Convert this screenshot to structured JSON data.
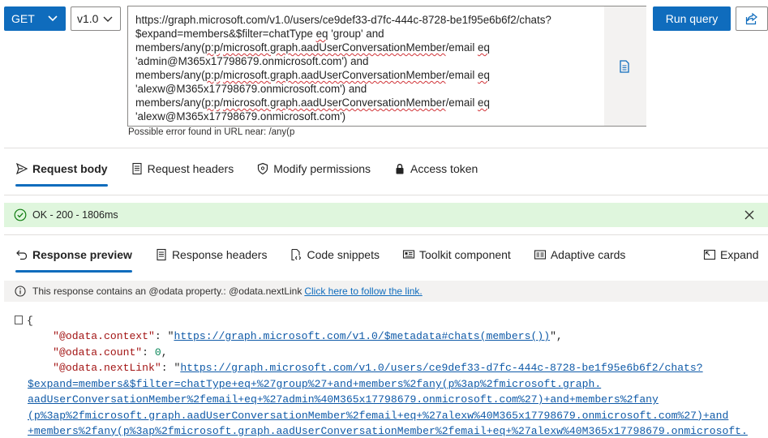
{
  "query": {
    "method": "GET",
    "version": "v1.0",
    "url_lines": [
      [
        {
          "t": "https://graph.microsoft.com/v1.0/users/ce9def33-d7fc-444c-8728-be1f95e6b6f2/chats?"
        }
      ],
      [
        {
          "t": "$expand=members&$filter=chatType "
        },
        {
          "t": "eq",
          "s": true
        },
        {
          "t": " 'group' and"
        }
      ],
      [
        {
          "t": "members/any("
        },
        {
          "t": "p:p",
          "s": true
        },
        {
          "t": "/"
        },
        {
          "t": "microsoft.graph.aadUserConversationMember",
          "s": true
        },
        {
          "t": "/email "
        },
        {
          "t": "eq",
          "s": true
        }
      ],
      [
        {
          "t": "'admin@M365x17798679.onmicrosoft.com') and"
        }
      ],
      [
        {
          "t": "members/any("
        },
        {
          "t": "p:p",
          "s": true
        },
        {
          "t": "/"
        },
        {
          "t": "microsoft.graph.aadUserConversationMember",
          "s": true
        },
        {
          "t": "/email "
        },
        {
          "t": "eq",
          "s": true
        }
      ],
      [
        {
          "t": "'alexw@M365x17798679.onmicrosoft.com') and"
        }
      ],
      [
        {
          "t": "members/any("
        },
        {
          "t": "p:p",
          "s": true
        },
        {
          "t": "/"
        },
        {
          "t": "microsoft.graph.aadUserConversationMember",
          "s": true
        },
        {
          "t": "/email "
        },
        {
          "t": "eq",
          "s": true
        }
      ],
      [
        {
          "t": "'alexw@M365x17798679.onmicrosoft.com')"
        }
      ]
    ],
    "error_hint": "Possible error found in URL near: /any(p",
    "run_label": "Run query"
  },
  "request_tabs": [
    {
      "label": "Request body",
      "icon": "send-icon",
      "active": true
    },
    {
      "label": "Request headers",
      "icon": "document-icon",
      "active": false
    },
    {
      "label": "Modify permissions",
      "icon": "shield-icon",
      "active": false
    },
    {
      "label": "Access token",
      "icon": "lock-icon",
      "active": false
    }
  ],
  "status": {
    "text": "OK - 200 - 1806ms",
    "color": "#dff6dd"
  },
  "response_tabs": [
    {
      "label": "Response preview",
      "icon": "undo-arrow-icon",
      "active": true
    },
    {
      "label": "Response headers",
      "icon": "document-icon",
      "active": false
    },
    {
      "label": "Code snippets",
      "icon": "code-file-icon",
      "active": false
    },
    {
      "label": "Toolkit component",
      "icon": "toolkit-icon",
      "active": false
    },
    {
      "label": "Adaptive cards",
      "icon": "card-icon",
      "active": false
    }
  ],
  "expand_label": "Expand",
  "info": {
    "text": "This response contains an @odata property.: @odata.nextLink",
    "link": "Click here to follow the link."
  },
  "response": {
    "open_brace": "{",
    "context_key": "\"@odata.context\"",
    "context_value": "https://graph.microsoft.com/v1.0/$metadata#chats(members())",
    "count_key": "\"@odata.count\"",
    "count_value": "0",
    "nextlink_key": "\"@odata.nextLink\"",
    "nextlink_lines": [
      "https://graph.microsoft.com/v1.0/users/ce9def33-d7fc-444c-8728-be1f95e6b6f2/chats?",
      "$expand=members&$filter=chatType+eq+%27group%27+and+members%2fany(p%3ap%2fmicrosoft.graph.",
      "aadUserConversationMember%2femail+eq+%27admin%40M365x17798679.onmicrosoft.com%27)+and+members%2fany",
      "(p%3ap%2fmicrosoft.graph.aadUserConversationMember%2femail+eq+%27alexw%40M365x17798679.onmicrosoft.com%27)+and",
      "+members%2fany(p%3ap%2fmicrosoft.graph.aadUserConversationMember%2femail+eq+%27alexw%40M365x17798679.onmicrosoft."
    ]
  },
  "colors": {
    "accent": "#0f6cbd",
    "success_bg": "#dff6dd",
    "info_bg": "#f3f2f1",
    "error_squiggle": "#d13438"
  }
}
